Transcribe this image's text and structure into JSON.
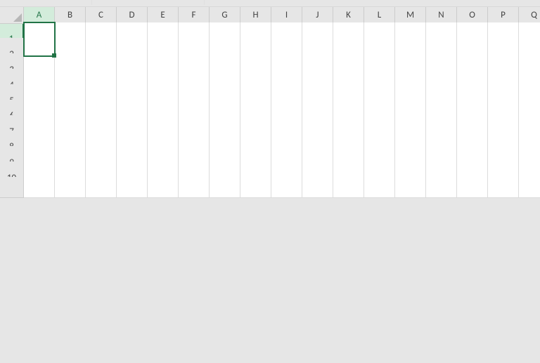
{
  "columns": [
    "A",
    "B",
    "C",
    "D",
    "E",
    "F",
    "G",
    "H",
    "I",
    "J",
    "K",
    "L",
    "M",
    "N",
    "O",
    "P",
    "Q"
  ],
  "rows": [
    "1",
    "2",
    "3",
    "4",
    "5",
    "6",
    "7",
    "8",
    "9",
    "10"
  ],
  "active_cell": {
    "col": "A",
    "row": "1"
  },
  "cells": {}
}
